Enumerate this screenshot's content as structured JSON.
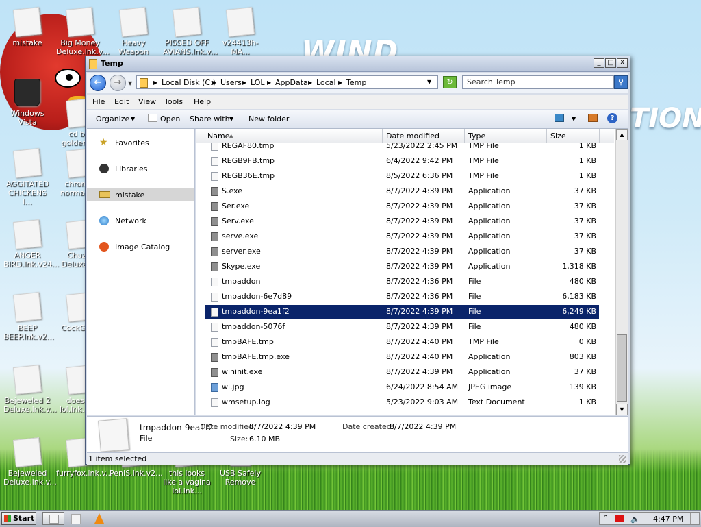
{
  "desktop": {
    "wallpaper_text": "WIND",
    "wallpaper_text2": "TION",
    "icons": [
      {
        "label": "mistake",
        "kind": "user"
      },
      {
        "label": "Big Money Deluxe.lnk.v...",
        "kind": "doc"
      },
      {
        "label": "Heavy Weapon Del...",
        "kind": "doc"
      },
      {
        "label": "PISSED OFF AVIANS.lnk.v...",
        "kind": "doc"
      },
      {
        "label": "v24413h-MA...",
        "kind": "doc"
      },
      {
        "label": "Windows Vista",
        "kind": "can"
      },
      {
        "label": "cd b... golden.l...",
        "kind": "doc"
      },
      {
        "label": "AGGITATED CHICKENS l...",
        "kind": "doc"
      },
      {
        "label": "chrom... normal.c...",
        "kind": "doc"
      },
      {
        "label": "ANGER BIRD.lnk.v24...",
        "kind": "doc"
      },
      {
        "label": "Chuz... Deluxe.l...",
        "kind": "doc"
      },
      {
        "label": "BEEP BEEP.lnk.v2...",
        "kind": "doc"
      },
      {
        "label": "CockGle...",
        "kind": "doc"
      },
      {
        "label": "Bejeweled 2 Deluxe.lnk.v...",
        "kind": "doc"
      },
      {
        "label": "doesn't lol.lnk.v2...",
        "kind": "doc"
      },
      {
        "label": "Bejeweled Deluxe.lnk.v...",
        "kind": "doc"
      },
      {
        "label": "furryfox.lnk.v...",
        "kind": "doc"
      },
      {
        "label": "PenIS.lnk.v2...",
        "kind": "doc"
      },
      {
        "label": "this looks like a vagina lol.lnk...",
        "kind": "doc"
      },
      {
        "label": "USB Safely Remove",
        "kind": "usb"
      }
    ]
  },
  "window": {
    "title": "Temp",
    "min": "_",
    "max": "□",
    "close": "X",
    "breadcrumbs": [
      "Local Disk (C:)",
      "Users",
      "LOL",
      "AppData",
      "Local",
      "Temp"
    ],
    "search_placeholder": "Search Temp",
    "menu": [
      "File",
      "Edit",
      "View",
      "Tools",
      "Help"
    ],
    "toolbar": {
      "organize": "Organize",
      "open": "Open",
      "share": "Share with",
      "new_folder": "New folder"
    },
    "nav": [
      {
        "label": "Favorites",
        "icon": "star-icon"
      },
      {
        "label": "Libraries",
        "icon": "libraries-icon"
      },
      {
        "label": "mistake",
        "icon": "user-folder-icon"
      },
      {
        "label": "Network",
        "icon": "network-icon"
      },
      {
        "label": "Image Catalog",
        "icon": "catalog-icon"
      }
    ],
    "columns": [
      "Name",
      "Date modified",
      "Type",
      "Size"
    ],
    "files": [
      {
        "name": "REGAF80.tmp",
        "date": "5/23/2022 2:45 PM",
        "type": "TMP File",
        "size": "1 KB",
        "icon": "file"
      },
      {
        "name": "REGB9FB.tmp",
        "date": "6/4/2022 9:42 PM",
        "type": "TMP File",
        "size": "1 KB",
        "icon": "file"
      },
      {
        "name": "REGB36E.tmp",
        "date": "8/5/2022 6:36 PM",
        "type": "TMP File",
        "size": "1 KB",
        "icon": "file"
      },
      {
        "name": "S.exe",
        "date": "8/7/2022 4:39 PM",
        "type": "Application",
        "size": "37 KB",
        "icon": "app"
      },
      {
        "name": "Ser.exe",
        "date": "8/7/2022 4:39 PM",
        "type": "Application",
        "size": "37 KB",
        "icon": "app"
      },
      {
        "name": "Serv.exe",
        "date": "8/7/2022 4:39 PM",
        "type": "Application",
        "size": "37 KB",
        "icon": "app"
      },
      {
        "name": "serve.exe",
        "date": "8/7/2022 4:39 PM",
        "type": "Application",
        "size": "37 KB",
        "icon": "app"
      },
      {
        "name": "server.exe",
        "date": "8/7/2022 4:39 PM",
        "type": "Application",
        "size": "37 KB",
        "icon": "app"
      },
      {
        "name": "Skype.exe",
        "date": "8/7/2022 4:39 PM",
        "type": "Application",
        "size": "1,318 KB",
        "icon": "app"
      },
      {
        "name": "tmpaddon",
        "date": "8/7/2022 4:36 PM",
        "type": "File",
        "size": "480 KB",
        "icon": "file"
      },
      {
        "name": "tmpaddon-6e7d89",
        "date": "8/7/2022 4:36 PM",
        "type": "File",
        "size": "6,183 KB",
        "icon": "file"
      },
      {
        "name": "tmpaddon-9ea1f2",
        "date": "8/7/2022 4:39 PM",
        "type": "File",
        "size": "6,249 KB",
        "icon": "file",
        "selected": true
      },
      {
        "name": "tmpaddon-5076f",
        "date": "8/7/2022 4:39 PM",
        "type": "File",
        "size": "480 KB",
        "icon": "file"
      },
      {
        "name": "tmpBAFE.tmp",
        "date": "8/7/2022 4:40 PM",
        "type": "TMP File",
        "size": "0 KB",
        "icon": "file"
      },
      {
        "name": "tmpBAFE.tmp.exe",
        "date": "8/7/2022 4:40 PM",
        "type": "Application",
        "size": "803 KB",
        "icon": "app"
      },
      {
        "name": "wininit.exe",
        "date": "8/7/2022 4:39 PM",
        "type": "Application",
        "size": "37 KB",
        "icon": "app"
      },
      {
        "name": "wl.jpg",
        "date": "6/24/2022 8:54 AM",
        "type": "JPEG image",
        "size": "139 KB",
        "icon": "jpg"
      },
      {
        "name": "wmsetup.log",
        "date": "5/23/2022 9:03 AM",
        "type": "Text Document",
        "size": "1 KB",
        "icon": "file"
      }
    ],
    "details": {
      "name": "tmpaddon-9ea1f2",
      "kind": "File",
      "date_modified_label": "Date modified:",
      "date_modified": "8/7/2022 4:39 PM",
      "date_created_label": "Date created:",
      "date_created": "8/7/2022 4:39 PM",
      "size_label": "Size:",
      "size": "6.10 MB"
    },
    "status": "1 item selected"
  },
  "taskbar": {
    "start": "Start",
    "clock": "4:47 PM"
  }
}
